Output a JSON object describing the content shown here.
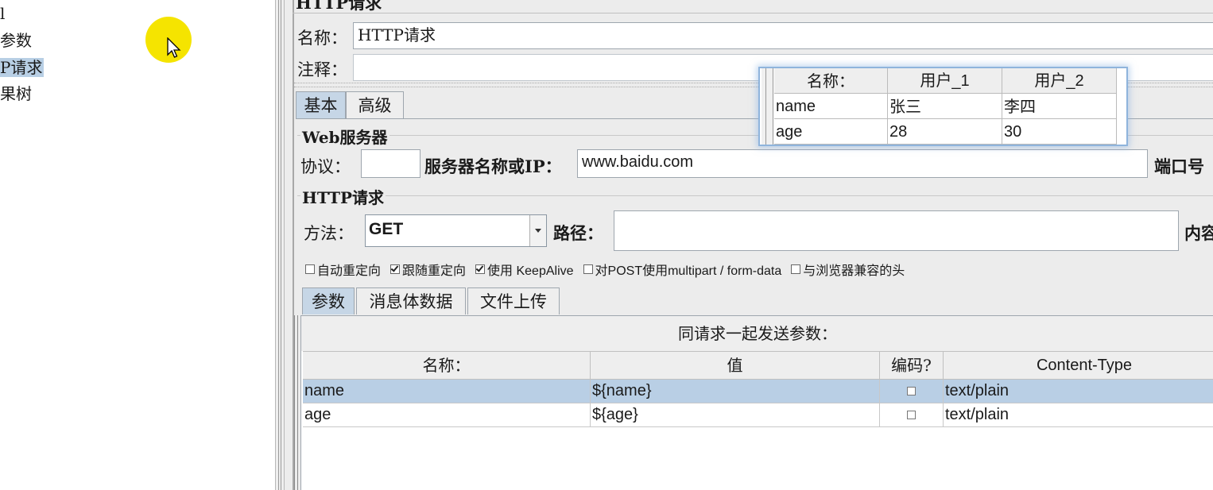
{
  "tree": {
    "items": [
      "l",
      "参数",
      "P请求",
      "果树"
    ],
    "selected_index": 2
  },
  "panel": {
    "title": "HTTP请求",
    "name_label": "名称：",
    "name_value": "HTTP请求",
    "comment_label": "注释：",
    "comment_value": "",
    "tabs": [
      "基本",
      "高级"
    ],
    "web_server": {
      "group_title": "Web服务器",
      "protocol_label": "协议：",
      "protocol_value": "",
      "server_label": "服务器名称或IP：",
      "server_value": "www.baidu.com",
      "port_label": "端口号"
    },
    "http_request": {
      "group_title": "HTTP请求",
      "method_label": "方法：",
      "method_value": "GET",
      "path_label": "路径：",
      "path_value": "",
      "content_label": "内容"
    },
    "checkboxes": [
      {
        "label": "自动重定向",
        "checked": false
      },
      {
        "label": "跟随重定向",
        "checked": true
      },
      {
        "label": "使用 KeepAlive",
        "checked": true
      },
      {
        "label": "对POST使用multipart / form-data",
        "checked": false
      },
      {
        "label": "与浏览器兼容的头",
        "checked": false
      }
    ],
    "sub_tabs": [
      "参数",
      "消息体数据",
      "文件上传"
    ],
    "params": {
      "caption": "同请求一起发送参数：",
      "headers": [
        "名称：",
        "值",
        "编码?",
        "Content-Type"
      ],
      "rows": [
        {
          "name": "name",
          "value": "${name}",
          "encode": false,
          "content_type": "text/plain"
        },
        {
          "name": "age",
          "value": "${age}",
          "encode": false,
          "content_type": "text/plain"
        }
      ]
    }
  },
  "popup": {
    "headers": [
      "名称：",
      "用户_1",
      "用户_2"
    ],
    "rows": [
      [
        "name",
        "张三",
        "李四"
      ],
      [
        "age",
        "28",
        "30"
      ]
    ]
  },
  "colors": {
    "selection": "#b9cfe5",
    "cursor_highlight": "#f5e400",
    "popup_border": "#8fb4dc"
  }
}
